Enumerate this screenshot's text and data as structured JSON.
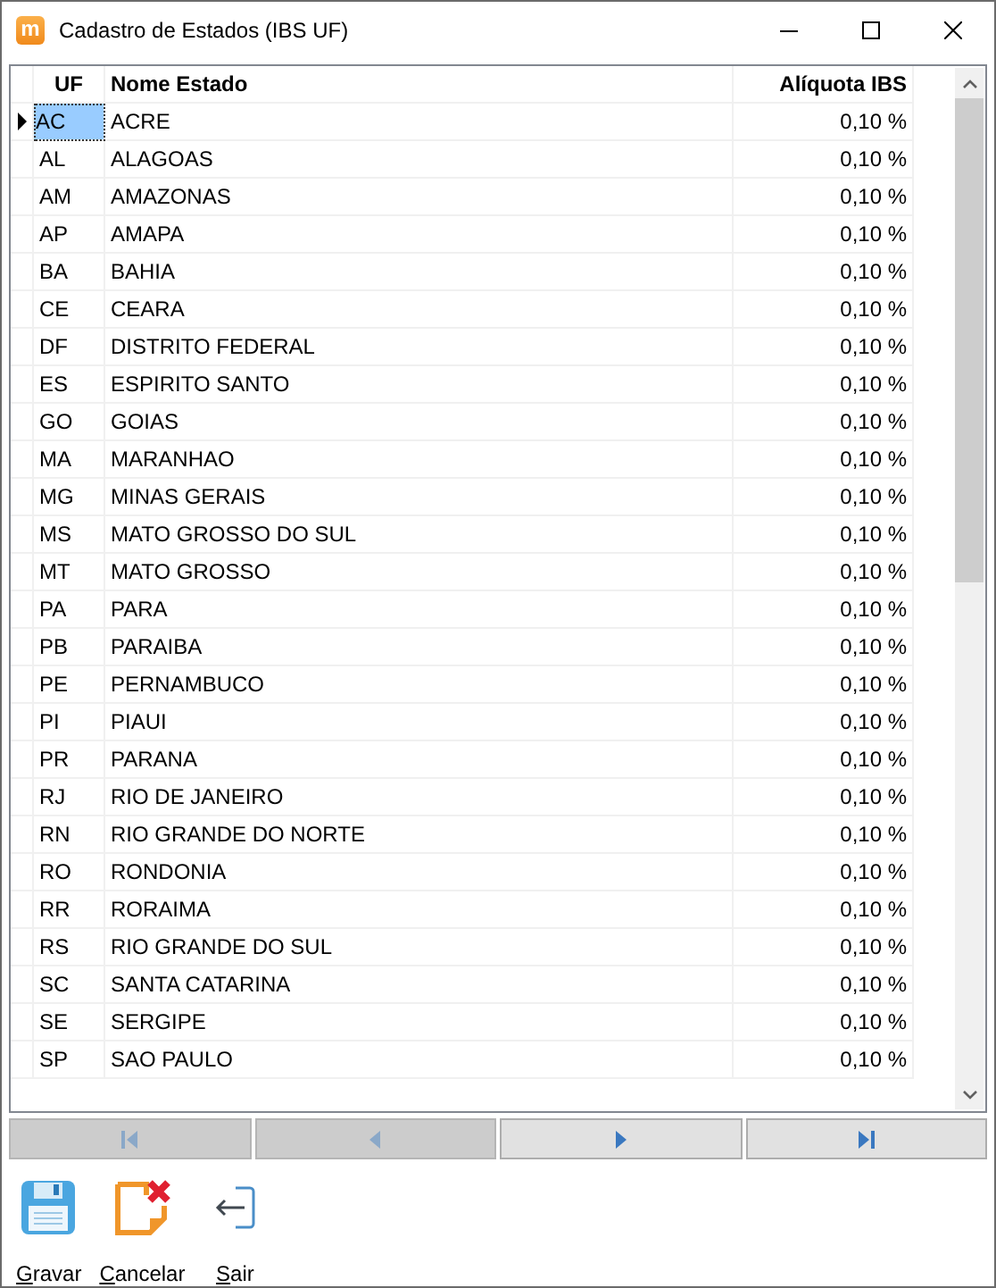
{
  "window": {
    "title": "Cadastro de Estados (IBS UF)",
    "icon_letter": "m"
  },
  "table": {
    "columns": [
      "UF",
      "Nome Estado",
      "Alíquota IBS"
    ],
    "rows": [
      {
        "uf": "AC",
        "nome": "ACRE",
        "aliquota": "0,10 %",
        "selected": true
      },
      {
        "uf": "AL",
        "nome": "ALAGOAS",
        "aliquota": "0,10 %",
        "selected": false
      },
      {
        "uf": "AM",
        "nome": "AMAZONAS",
        "aliquota": "0,10 %",
        "selected": false
      },
      {
        "uf": "AP",
        "nome": "AMAPA",
        "aliquota": "0,10 %",
        "selected": false
      },
      {
        "uf": "BA",
        "nome": "BAHIA",
        "aliquota": "0,10 %",
        "selected": false
      },
      {
        "uf": "CE",
        "nome": "CEARA",
        "aliquota": "0,10 %",
        "selected": false
      },
      {
        "uf": "DF",
        "nome": "DISTRITO FEDERAL",
        "aliquota": "0,10 %",
        "selected": false
      },
      {
        "uf": "ES",
        "nome": "ESPIRITO SANTO",
        "aliquota": "0,10 %",
        "selected": false
      },
      {
        "uf": "GO",
        "nome": "GOIAS",
        "aliquota": "0,10 %",
        "selected": false
      },
      {
        "uf": "MA",
        "nome": "MARANHAO",
        "aliquota": "0,10 %",
        "selected": false
      },
      {
        "uf": "MG",
        "nome": "MINAS GERAIS",
        "aliquota": "0,10 %",
        "selected": false
      },
      {
        "uf": "MS",
        "nome": "MATO GROSSO DO SUL",
        "aliquota": "0,10 %",
        "selected": false
      },
      {
        "uf": "MT",
        "nome": "MATO GROSSO",
        "aliquota": "0,10 %",
        "selected": false
      },
      {
        "uf": "PA",
        "nome": "PARA",
        "aliquota": "0,10 %",
        "selected": false
      },
      {
        "uf": "PB",
        "nome": "PARAIBA",
        "aliquota": "0,10 %",
        "selected": false
      },
      {
        "uf": "PE",
        "nome": "PERNAMBUCO",
        "aliquota": "0,10 %",
        "selected": false
      },
      {
        "uf": "PI",
        "nome": "PIAUI",
        "aliquota": "0,10 %",
        "selected": false
      },
      {
        "uf": "PR",
        "nome": "PARANA",
        "aliquota": "0,10 %",
        "selected": false
      },
      {
        "uf": "RJ",
        "nome": "RIO DE JANEIRO",
        "aliquota": "0,10 %",
        "selected": false
      },
      {
        "uf": "RN",
        "nome": "RIO GRANDE DO NORTE",
        "aliquota": "0,10 %",
        "selected": false
      },
      {
        "uf": "RO",
        "nome": "RONDONIA",
        "aliquota": "0,10 %",
        "selected": false
      },
      {
        "uf": "RR",
        "nome": "RORAIMA",
        "aliquota": "0,10 %",
        "selected": false
      },
      {
        "uf": "RS",
        "nome": "RIO GRANDE DO SUL",
        "aliquota": "0,10 %",
        "selected": false
      },
      {
        "uf": "SC",
        "nome": "SANTA CATARINA",
        "aliquota": "0,10 %",
        "selected": false
      },
      {
        "uf": "SE",
        "nome": "SERGIPE",
        "aliquota": "0,10 %",
        "selected": false
      },
      {
        "uf": "SP",
        "nome": "SAO PAULO",
        "aliquota": "0,10 %",
        "selected": false
      }
    ]
  },
  "navigator": [
    {
      "kind": "first",
      "disabled": true
    },
    {
      "kind": "prior",
      "disabled": true
    },
    {
      "kind": "next",
      "disabled": false
    },
    {
      "kind": "last",
      "disabled": false
    }
  ],
  "toolbar": [
    {
      "kind": "save",
      "label": "Gravar"
    },
    {
      "kind": "cancel",
      "label": "Cancelar"
    },
    {
      "kind": "exit",
      "label": "Sair"
    }
  ]
}
